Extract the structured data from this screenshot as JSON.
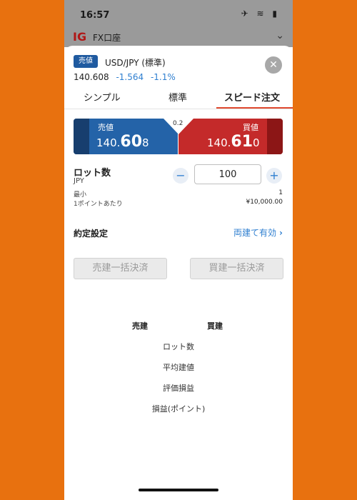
{
  "status": {
    "time": "16:57",
    "icons": "✈ ≋ ▮"
  },
  "account": {
    "logo": "IG",
    "name": "FX口座",
    "chevron": "⌄"
  },
  "ticket": {
    "side_badge": "売値",
    "pair": "USD/JPY (標準)",
    "price": "140.608",
    "change": "-1.564",
    "change_pct": "-1.1%",
    "close_symbol": "✕"
  },
  "tabs": [
    {
      "label": "シンプル",
      "active": false
    },
    {
      "label": "標準",
      "active": false
    },
    {
      "label": "スピード注文",
      "active": true
    }
  ],
  "quote": {
    "bid_label": "売値",
    "bid_prefix": "140.",
    "bid_big": "60",
    "bid_suffix": "8",
    "ask_label": "買値",
    "ask_prefix": "140.",
    "ask_big": "61",
    "ask_suffix": "0",
    "spread": "0.2"
  },
  "lot": {
    "title": "ロット数",
    "unit": "JPY",
    "value": "100",
    "minus": "−",
    "plus": "+",
    "min_label": "最小",
    "min_value": "1",
    "per_point_label": "1ポイントあたり",
    "per_point_value": "¥10,000.00"
  },
  "settlement": {
    "label": "約定設定",
    "value": "両建て有効",
    "arrow": "›"
  },
  "bulk": {
    "sell_close": "売建一括決済",
    "buy_close": "買建一括決済"
  },
  "positions": {
    "sell_header": "売建",
    "buy_header": "買建",
    "rows": [
      "ロット数",
      "平均建値",
      "評価損益",
      "損益(ポイント)"
    ]
  },
  "colors": {
    "background": "#E8710F",
    "bid": "#2463A8",
    "ask": "#C42A2A",
    "accent": "#2F7FD0"
  }
}
